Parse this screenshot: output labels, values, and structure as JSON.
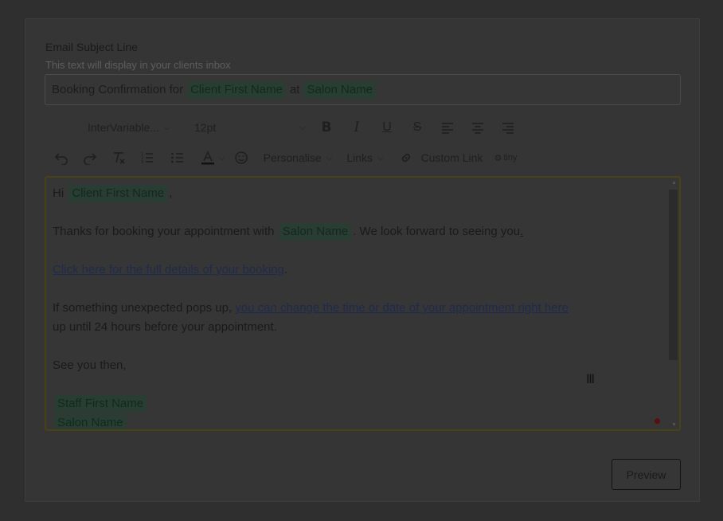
{
  "subject": {
    "label": "Email Subject Line",
    "help": "This text will display in your clients inbox",
    "parts": {
      "prefix": "Booking Confirmation for",
      "chip1": "Client First Name",
      "middle": "at",
      "chip2": "Salon Name"
    }
  },
  "toolbar": {
    "font_family": "InterVariable...",
    "font_size": "12pt",
    "bold": "B",
    "italic": "I",
    "underline": "U",
    "strike": "S",
    "personalise": "Personalise",
    "links": "Links",
    "custom_link": "Custom Link",
    "tiny": "tiny"
  },
  "editor": {
    "hi": "Hi",
    "client_chip": "Client First Name",
    "comma": ",",
    "thanks_prefix": "Thanks for booking your appointment with",
    "salon_chip": "Salon Name",
    "thanks_suffix": ". We look forward to seeing you",
    "thanks_end": ".",
    "details_link": "Click here for the full details of your booking",
    "details_end": ".",
    "unexpected_prefix": "If something unexpected pops up,",
    "change_link": "you can change the time or date of your appointment right here",
    "unexpected_line2": "up until 24 hours before your appointment.",
    "see_you": "See you then,",
    "staff_chip": "Staff First Name",
    "salon_chip2": "Salon Name"
  },
  "preview_label": "Preview",
  "colors": {
    "background": "#2f2f2f",
    "chip_bg": "#2a3d33",
    "link": "#1e2a4f",
    "editor_border": "#4a4213"
  }
}
